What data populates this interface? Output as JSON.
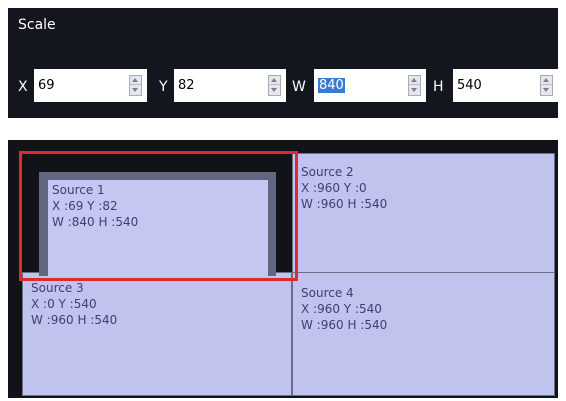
{
  "scale": {
    "title": "Scale",
    "fields": {
      "x": {
        "label": "X",
        "value": "69"
      },
      "y": {
        "label": "Y",
        "value": "82"
      },
      "w": {
        "label": "W",
        "value": "840"
      },
      "h": {
        "label": "H",
        "value": "540"
      }
    }
  },
  "sources": {
    "source1": {
      "name": "Source 1",
      "pos": "X :69 Y :82",
      "size": "W :840 H :540"
    },
    "source2": {
      "name": "Source 2",
      "pos": "X :960 Y :0",
      "size": "W :960 H :540"
    },
    "source3": {
      "name": "Source 3",
      "pos": "X :0 Y :540",
      "size": "W :960 H :540"
    },
    "source4": {
      "name": "Source 4",
      "pos": "X :960 Y :540",
      "size": "W :960 H :540"
    }
  },
  "colors": {
    "panel_bg": "#13151f",
    "window_fill": "#bfc3ee",
    "selection_border": "#e02b2b",
    "text_selection": "#3a7bd5"
  }
}
